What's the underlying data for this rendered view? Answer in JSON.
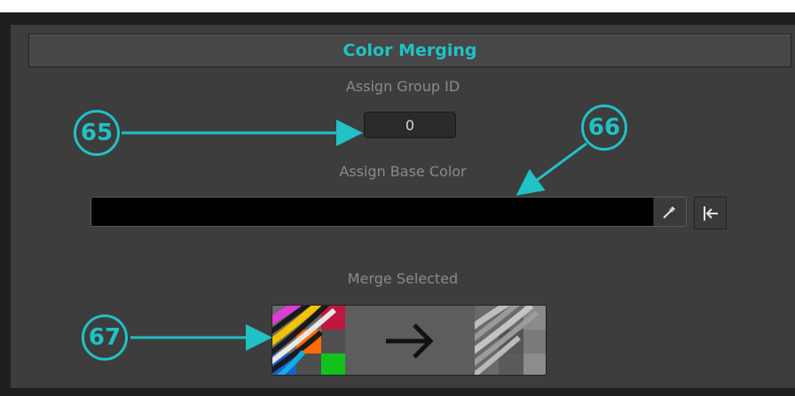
{
  "section": {
    "title": "Color Merging"
  },
  "group_id": {
    "label": "Assign Group ID",
    "value": "0"
  },
  "base_color": {
    "label": "Assign Base Color",
    "value": "#000000",
    "picker_icon": "eyedropper-icon",
    "reset_icon": "arrow-to-left-bar-icon"
  },
  "merge": {
    "label": "Merge Selected",
    "icon": "right-arrow-icon"
  },
  "callouts": [
    "65",
    "66",
    "67"
  ],
  "colors": {
    "accent": "#21c1c5",
    "panel": "#3d3d3d",
    "header": "#474747"
  }
}
